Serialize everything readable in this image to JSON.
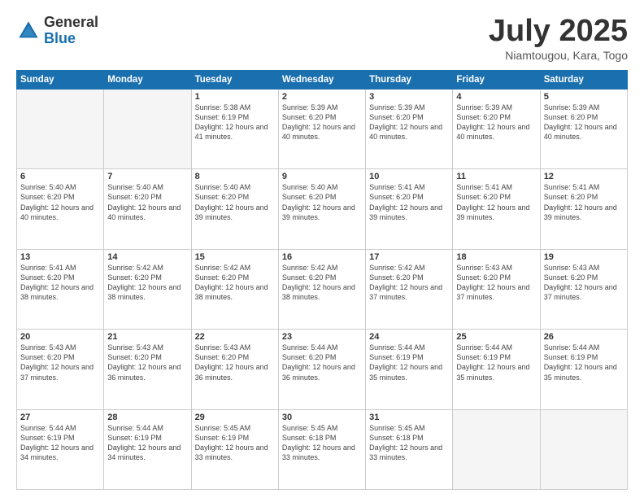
{
  "logo": {
    "general": "General",
    "blue": "Blue"
  },
  "title": "July 2025",
  "subtitle": "Niamtougou, Kara, Togo",
  "headers": [
    "Sunday",
    "Monday",
    "Tuesday",
    "Wednesday",
    "Thursday",
    "Friday",
    "Saturday"
  ],
  "weeks": [
    [
      {
        "day": "",
        "info": ""
      },
      {
        "day": "",
        "info": ""
      },
      {
        "day": "1",
        "info": "Sunrise: 5:38 AM\nSunset: 6:19 PM\nDaylight: 12 hours and 41 minutes."
      },
      {
        "day": "2",
        "info": "Sunrise: 5:39 AM\nSunset: 6:20 PM\nDaylight: 12 hours and 40 minutes."
      },
      {
        "day": "3",
        "info": "Sunrise: 5:39 AM\nSunset: 6:20 PM\nDaylight: 12 hours and 40 minutes."
      },
      {
        "day": "4",
        "info": "Sunrise: 5:39 AM\nSunset: 6:20 PM\nDaylight: 12 hours and 40 minutes."
      },
      {
        "day": "5",
        "info": "Sunrise: 5:39 AM\nSunset: 6:20 PM\nDaylight: 12 hours and 40 minutes."
      }
    ],
    [
      {
        "day": "6",
        "info": "Sunrise: 5:40 AM\nSunset: 6:20 PM\nDaylight: 12 hours and 40 minutes."
      },
      {
        "day": "7",
        "info": "Sunrise: 5:40 AM\nSunset: 6:20 PM\nDaylight: 12 hours and 40 minutes."
      },
      {
        "day": "8",
        "info": "Sunrise: 5:40 AM\nSunset: 6:20 PM\nDaylight: 12 hours and 39 minutes."
      },
      {
        "day": "9",
        "info": "Sunrise: 5:40 AM\nSunset: 6:20 PM\nDaylight: 12 hours and 39 minutes."
      },
      {
        "day": "10",
        "info": "Sunrise: 5:41 AM\nSunset: 6:20 PM\nDaylight: 12 hours and 39 minutes."
      },
      {
        "day": "11",
        "info": "Sunrise: 5:41 AM\nSunset: 6:20 PM\nDaylight: 12 hours and 39 minutes."
      },
      {
        "day": "12",
        "info": "Sunrise: 5:41 AM\nSunset: 6:20 PM\nDaylight: 12 hours and 39 minutes."
      }
    ],
    [
      {
        "day": "13",
        "info": "Sunrise: 5:41 AM\nSunset: 6:20 PM\nDaylight: 12 hours and 38 minutes."
      },
      {
        "day": "14",
        "info": "Sunrise: 5:42 AM\nSunset: 6:20 PM\nDaylight: 12 hours and 38 minutes."
      },
      {
        "day": "15",
        "info": "Sunrise: 5:42 AM\nSunset: 6:20 PM\nDaylight: 12 hours and 38 minutes."
      },
      {
        "day": "16",
        "info": "Sunrise: 5:42 AM\nSunset: 6:20 PM\nDaylight: 12 hours and 38 minutes."
      },
      {
        "day": "17",
        "info": "Sunrise: 5:42 AM\nSunset: 6:20 PM\nDaylight: 12 hours and 37 minutes."
      },
      {
        "day": "18",
        "info": "Sunrise: 5:43 AM\nSunset: 6:20 PM\nDaylight: 12 hours and 37 minutes."
      },
      {
        "day": "19",
        "info": "Sunrise: 5:43 AM\nSunset: 6:20 PM\nDaylight: 12 hours and 37 minutes."
      }
    ],
    [
      {
        "day": "20",
        "info": "Sunrise: 5:43 AM\nSunset: 6:20 PM\nDaylight: 12 hours and 37 minutes."
      },
      {
        "day": "21",
        "info": "Sunrise: 5:43 AM\nSunset: 6:20 PM\nDaylight: 12 hours and 36 minutes."
      },
      {
        "day": "22",
        "info": "Sunrise: 5:43 AM\nSunset: 6:20 PM\nDaylight: 12 hours and 36 minutes."
      },
      {
        "day": "23",
        "info": "Sunrise: 5:44 AM\nSunset: 6:20 PM\nDaylight: 12 hours and 36 minutes."
      },
      {
        "day": "24",
        "info": "Sunrise: 5:44 AM\nSunset: 6:19 PM\nDaylight: 12 hours and 35 minutes."
      },
      {
        "day": "25",
        "info": "Sunrise: 5:44 AM\nSunset: 6:19 PM\nDaylight: 12 hours and 35 minutes."
      },
      {
        "day": "26",
        "info": "Sunrise: 5:44 AM\nSunset: 6:19 PM\nDaylight: 12 hours and 35 minutes."
      }
    ],
    [
      {
        "day": "27",
        "info": "Sunrise: 5:44 AM\nSunset: 6:19 PM\nDaylight: 12 hours and 34 minutes."
      },
      {
        "day": "28",
        "info": "Sunrise: 5:44 AM\nSunset: 6:19 PM\nDaylight: 12 hours and 34 minutes."
      },
      {
        "day": "29",
        "info": "Sunrise: 5:45 AM\nSunset: 6:19 PM\nDaylight: 12 hours and 33 minutes."
      },
      {
        "day": "30",
        "info": "Sunrise: 5:45 AM\nSunset: 6:18 PM\nDaylight: 12 hours and 33 minutes."
      },
      {
        "day": "31",
        "info": "Sunrise: 5:45 AM\nSunset: 6:18 PM\nDaylight: 12 hours and 33 minutes."
      },
      {
        "day": "",
        "info": ""
      },
      {
        "day": "",
        "info": ""
      }
    ]
  ]
}
